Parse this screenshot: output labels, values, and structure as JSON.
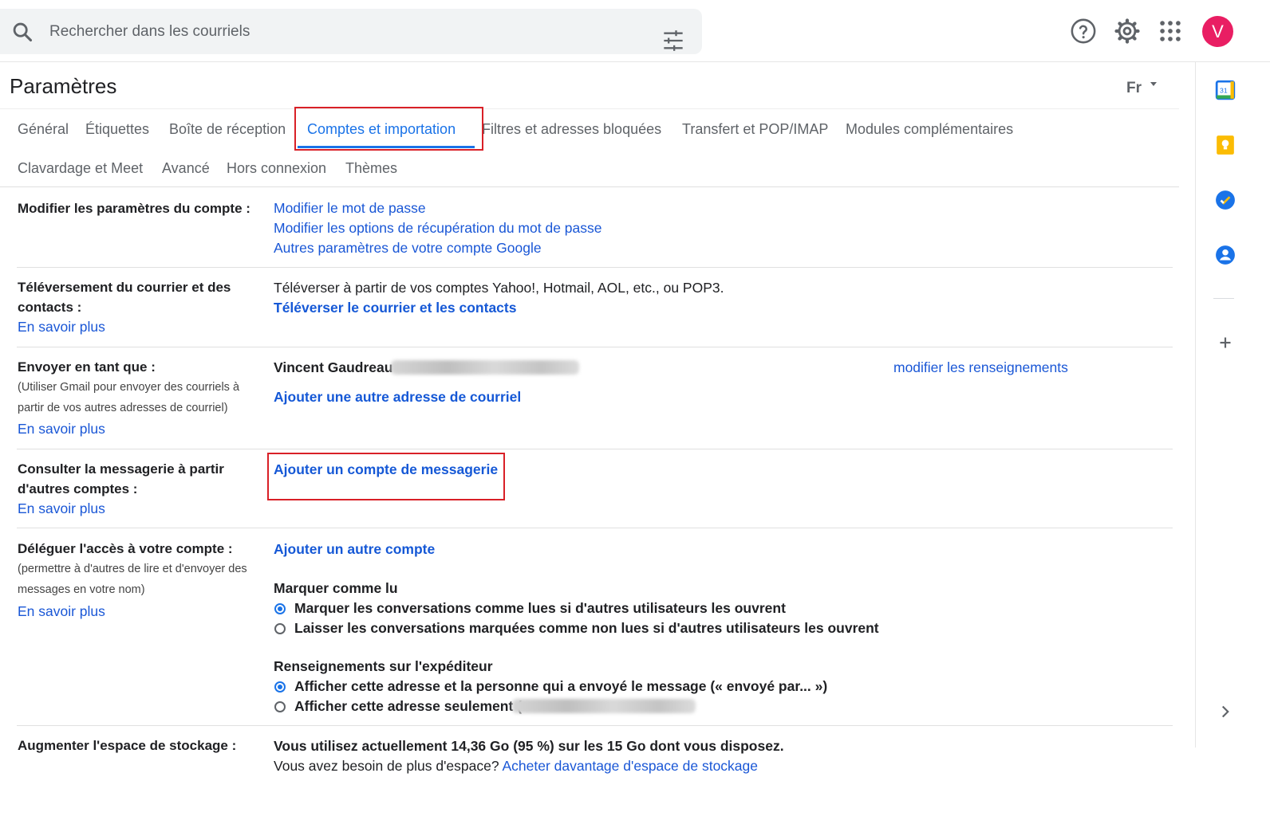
{
  "search": {
    "placeholder": "Rechercher dans les courriels"
  },
  "user": {
    "avatar_letter": "V",
    "avatar_color": "#e91e63"
  },
  "header": {
    "title": "Paramètres",
    "language": "Fr"
  },
  "tabs": [
    {
      "label": "Général"
    },
    {
      "label": "Étiquettes"
    },
    {
      "label": "Boîte de réception"
    },
    {
      "label": "Comptes et importation"
    },
    {
      "label": "Filtres et adresses bloquées"
    },
    {
      "label": "Transfert et POP/IMAP"
    },
    {
      "label": "Modules complémentaires"
    },
    {
      "label": "Clavardage et Meet"
    },
    {
      "label": "Avancé"
    },
    {
      "label": "Hors connexion"
    },
    {
      "label": "Thèmes"
    }
  ],
  "active_tab": "Comptes et importation",
  "sections": {
    "account": {
      "label": "Modifier les paramètres du compte :",
      "links": [
        "Modifier le mot de passe",
        "Modifier les options de récupération du mot de passe",
        "Autres paramètres de votre compte Google"
      ]
    },
    "import": {
      "label_line1": "Téléversement du courrier et des",
      "label_line2": "contacts :",
      "learn_more": "En savoir plus",
      "description": "Téléverser à partir de vos comptes Yahoo!, Hotmail, AOL, etc., ou POP3.",
      "action": "Téléverser le courrier et les contacts"
    },
    "send_as": {
      "label": "Envoyer en tant que :",
      "sub_line1": "(Utiliser Gmail pour envoyer des courriels à",
      "sub_line2": "partir de vos autres adresses de courriel)",
      "learn_more": "En savoir plus",
      "name": "Vincent Gaudreau",
      "edit": "modifier les renseignements",
      "add": "Ajouter une autre adresse de courriel"
    },
    "check_mail": {
      "label_line1": "Consulter la messagerie à partir",
      "label_line2": "d'autres comptes :",
      "learn_more": "En savoir plus",
      "add": "Ajouter un compte de messagerie"
    },
    "delegate": {
      "label": "Déléguer l'accès à votre compte :",
      "sub_line1": "(permettre à d'autres de lire et d'envoyer des",
      "sub_line2": "messages en votre nom)",
      "learn_more": "En savoir plus",
      "add": "Ajouter un autre compte",
      "mark_read_title": "Marquer comme lu",
      "mark_read_options": [
        "Marquer les conversations comme lues si d'autres utilisateurs les ouvrent",
        "Laisser les conversations marquées comme non lues si d'autres utilisateurs les ouvrent"
      ],
      "mark_read_selected": 0,
      "sender_info_title": "Renseignements sur l'expéditeur",
      "sender_info_options": [
        "Afficher cette adresse et la personne qui a envoyé le message (« envoyé par... »)",
        "Afficher cette adresse seulement ("
      ],
      "sender_info_selected": 0
    },
    "storage": {
      "label": "Augmenter l'espace de stockage :",
      "usage": "Vous utilisez actuellement 14,36 Go (95 %) sur les 15 Go dont vous disposez.",
      "need_more": "Vous avez besoin de plus d'espace?",
      "buy": "Acheter davantage d'espace de stockage"
    }
  },
  "colors": {
    "link": "#1a57d6",
    "highlight": "#d92027",
    "active_tab": "#1a73e8"
  }
}
